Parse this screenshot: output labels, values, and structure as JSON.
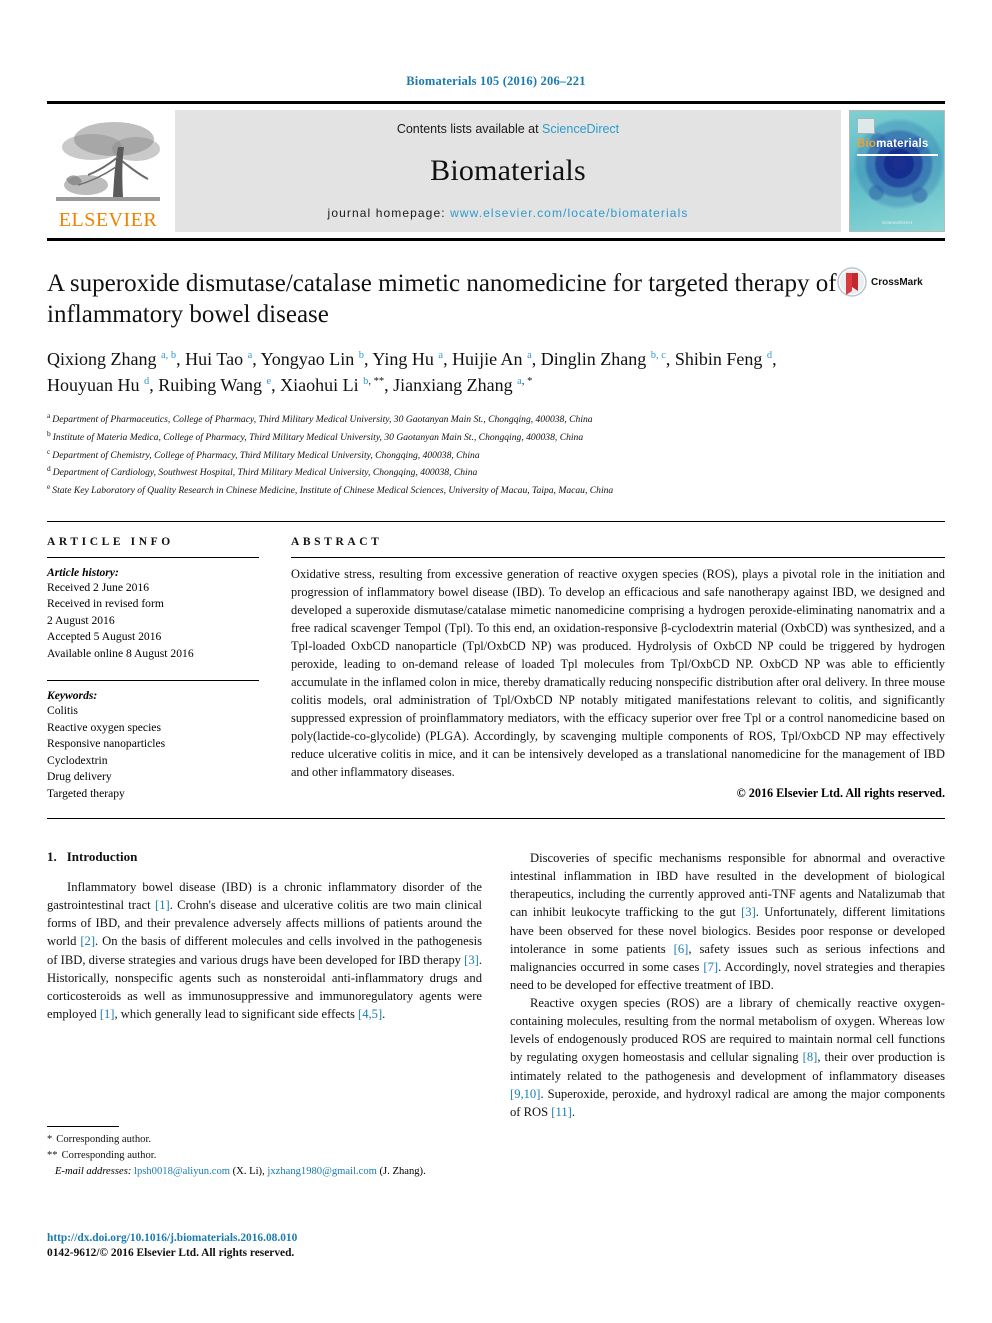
{
  "running_head": "Biomaterials 105 (2016) 206–221",
  "masthead": {
    "contents_prefix": "Contents lists available at ",
    "sciencedirect": "ScienceDirect",
    "journal_name": "Biomaterials",
    "homepage_prefix": "journal homepage: ",
    "homepage_url": "www.elsevier.com/locate/biomaterials",
    "publisher_logo_text": "ELSEVIER",
    "cover": {
      "title_bio": "Bio",
      "title_rest": "materials",
      "footer": "ScienceDirect"
    },
    "colors": {
      "link": "#2e9bcc",
      "elsevier_orange": "#ef8200",
      "panel_gray": "#e3e3e3"
    }
  },
  "article": {
    "title": "A superoxide dismutase/catalase mimetic nanomedicine for targeted therapy of inflammatory bowel disease",
    "crossmark_label": "CrossMark",
    "authors": [
      {
        "name": "Qixiong Zhang",
        "sup": "a, b",
        "sep": ", "
      },
      {
        "name": "Hui Tao",
        "sup": "a",
        "sep": ", "
      },
      {
        "name": "Yongyao Lin",
        "sup": "b",
        "sep": ", "
      },
      {
        "name": "Ying Hu",
        "sup": "a",
        "sep": ", "
      },
      {
        "name": "Huijie An",
        "sup": "a",
        "sep": ", "
      },
      {
        "name": "Dinglin Zhang",
        "sup": "b, c",
        "sep": ", "
      },
      {
        "name": "Shibin Feng",
        "sup": "d",
        "sep": ", "
      },
      {
        "name": "Houyuan Hu",
        "sup": "d",
        "sep": ", "
      },
      {
        "name": "Ruibing Wang",
        "sup": "e",
        "sep": ", "
      },
      {
        "name": "Xiaohui Li",
        "sup": "b",
        "star": "**",
        "sep": ", "
      },
      {
        "name": "Jianxiang Zhang",
        "sup": "a",
        "star": "*",
        "sep": ""
      }
    ],
    "affiliations": [
      {
        "marker": "a",
        "text": "Department of Pharmaceutics, College of Pharmacy, Third Military Medical University, 30 Gaotanyan Main St., Chongqing, 400038, China"
      },
      {
        "marker": "b",
        "text": "Institute of Materia Medica, College of Pharmacy, Third Military Medical University, 30 Gaotanyan Main St., Chongqing, 400038, China"
      },
      {
        "marker": "c",
        "text": "Department of Chemistry, College of Pharmacy, Third Military Medical University, Chongqing, 400038, China"
      },
      {
        "marker": "d",
        "text": "Department of Cardiology, Southwest Hospital, Third Military Medical University, Chongqing, 400038, China"
      },
      {
        "marker": "e",
        "text": "State Key Laboratory of Quality Research in Chinese Medicine, Institute of Chinese Medical Sciences, University of Macau, Taipa, Macau, China"
      }
    ]
  },
  "article_info": {
    "label": "ARTICLE INFO",
    "history_heading": "Article history:",
    "history": [
      "Received 2 June 2016",
      "Received in revised form",
      "2 August 2016",
      "Accepted 5 August 2016",
      "Available online 8 August 2016"
    ],
    "keywords_heading": "Keywords:",
    "keywords": [
      "Colitis",
      "Reactive oxygen species",
      "Responsive nanoparticles",
      "Cyclodextrin",
      "Drug delivery",
      "Targeted therapy"
    ]
  },
  "abstract": {
    "label": "ABSTRACT",
    "text": "Oxidative stress, resulting from excessive generation of reactive oxygen species (ROS), plays a pivotal role in the initiation and progression of inflammatory bowel disease (IBD). To develop an efficacious and safe nanotherapy against IBD, we designed and developed a superoxide dismutase/catalase mimetic nanomedicine comprising a hydrogen peroxide-eliminating nanomatrix and a free radical scavenger Tempol (Tpl). To this end, an oxidation-responsive β-cyclodextrin material (OxbCD) was synthesized, and a Tpl-loaded OxbCD nanoparticle (Tpl/OxbCD NP) was produced. Hydrolysis of OxbCD NP could be triggered by hydrogen peroxide, leading to on-demand release of loaded Tpl molecules from Tpl/OxbCD NP. OxbCD NP was able to efficiently accumulate in the inflamed colon in mice, thereby dramatically reducing nonspecific distribution after oral delivery. In three mouse colitis models, oral administration of Tpl/OxbCD NP notably mitigated manifestations relevant to colitis, and significantly suppressed expression of proinflammatory mediators, with the efficacy superior over free Tpl or a control nanomedicine based on poly(lactide-co-glycolide) (PLGA). Accordingly, by scavenging multiple components of ROS, Tpl/OxbCD NP may effectively reduce ulcerative colitis in mice, and it can be intensively developed as a translational nanomedicine for the management of IBD and other inflammatory diseases.",
    "copyright": "© 2016 Elsevier Ltd. All rights reserved."
  },
  "introduction": {
    "number": "1.",
    "heading": "Introduction",
    "left_paragraphs": [
      "Inflammatory bowel disease (IBD) is a chronic inflammatory disorder of the gastrointestinal tract [1]. Crohn's disease and ulcerative colitis are two main clinical forms of IBD, and their prevalence adversely affects millions of patients around the world [2]. On the basis of different molecules and cells involved in the pathogenesis of IBD, diverse strategies and various drugs have been developed for IBD therapy [3]. Historically, nonspecific agents such as nonsteroidal anti-inflammatory drugs and corticosteroids as well as immunosuppressive and immunoregulatory agents were employed [1], which generally lead to significant side effects [4,5]."
    ],
    "right_paragraphs": [
      "Discoveries of specific mechanisms responsible for abnormal and overactive intestinal inflammation in IBD have resulted in the development of biological therapeutics, including the currently approved anti-TNF agents and Natalizumab that can inhibit leukocyte trafficking to the gut [3]. Unfortunately, different limitations have been observed for these novel biologics. Besides poor response or developed intolerance in some patients [6], safety issues such as serious infections and malignancies occurred in some cases [7]. Accordingly, novel strategies and therapies need to be developed for effective treatment of IBD.",
      "Reactive oxygen species (ROS) are a library of chemically reactive oxygen-containing molecules, resulting from the normal metabolism of oxygen. Whereas low levels of endogenously produced ROS are required to maintain normal cell functions by regulating oxygen homeostasis and cellular signaling [8], their over production is intimately related to the pathogenesis and development of inflammatory diseases [9,10]. Superoxide, peroxide, and hydroxyl radical are among the major components of ROS [11]."
    ]
  },
  "footnotes": {
    "star_single": "*",
    "star_double": "**",
    "corresponding_1": "Corresponding author.",
    "corresponding_2": "Corresponding author.",
    "email_label": "E-mail addresses:",
    "email_1": "lpsh0018@aliyun.com",
    "email_1_owner": "(X. Li)",
    "email_2": "jxzhang1980@gmail.com",
    "email_2_owner": "(J. Zhang)."
  },
  "doi": {
    "url": "http://dx.doi.org/10.1016/j.biomaterials.2016.08.010",
    "issn_line": "0142-9612/© 2016 Elsevier Ltd. All rights reserved."
  }
}
